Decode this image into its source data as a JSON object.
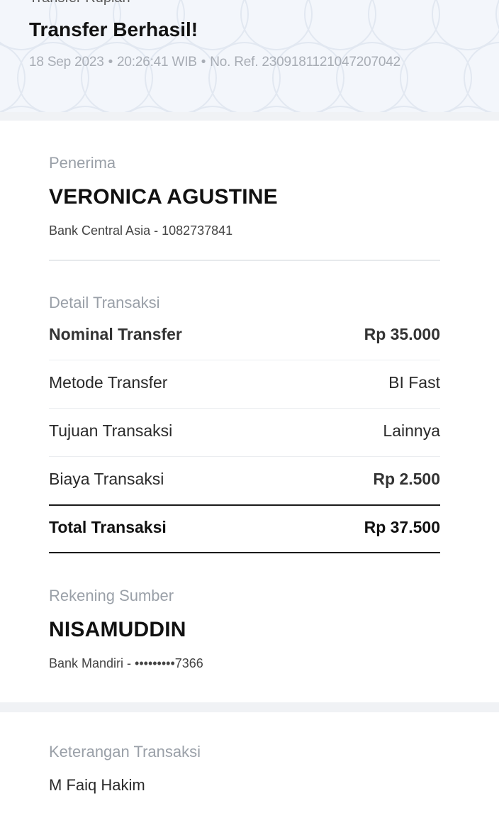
{
  "header": {
    "subtitle": "Transfer Rupiah",
    "title": "Transfer Berhasil!",
    "date": "18 Sep 2023",
    "time": "20:26:41 WIB",
    "ref": "No. Ref. 2309181121047207042",
    "separator": "•"
  },
  "recipient": {
    "label": "Penerima",
    "name": "VERONICA AGUSTINE",
    "bank_info": "Bank Central Asia - 1082737841"
  },
  "details": {
    "label": "Detail Transaksi",
    "rows": [
      {
        "key": "Nominal Transfer",
        "value": "Rp 35.000"
      },
      {
        "key": "Metode Transfer",
        "value": "BI Fast"
      },
      {
        "key": "Tujuan Transaksi",
        "value": "Lainnya"
      },
      {
        "key": "Biaya Transaksi",
        "value": "Rp 2.500"
      }
    ],
    "total": {
      "key": "Total Transaksi",
      "value": "Rp 37.500"
    }
  },
  "source": {
    "label": "Rekening Sumber",
    "name": "NISAMUDDIN",
    "bank_info": "Bank Mandiri - •••••••••7366"
  },
  "note": {
    "label": "Keterangan Transaksi",
    "text": "M Faiq Hakim"
  },
  "colors": {
    "header_bg": "#f3f6fb",
    "pattern": "#e3e9f2",
    "muted_text": "#9aa0a8",
    "primary_text": "#111111"
  }
}
